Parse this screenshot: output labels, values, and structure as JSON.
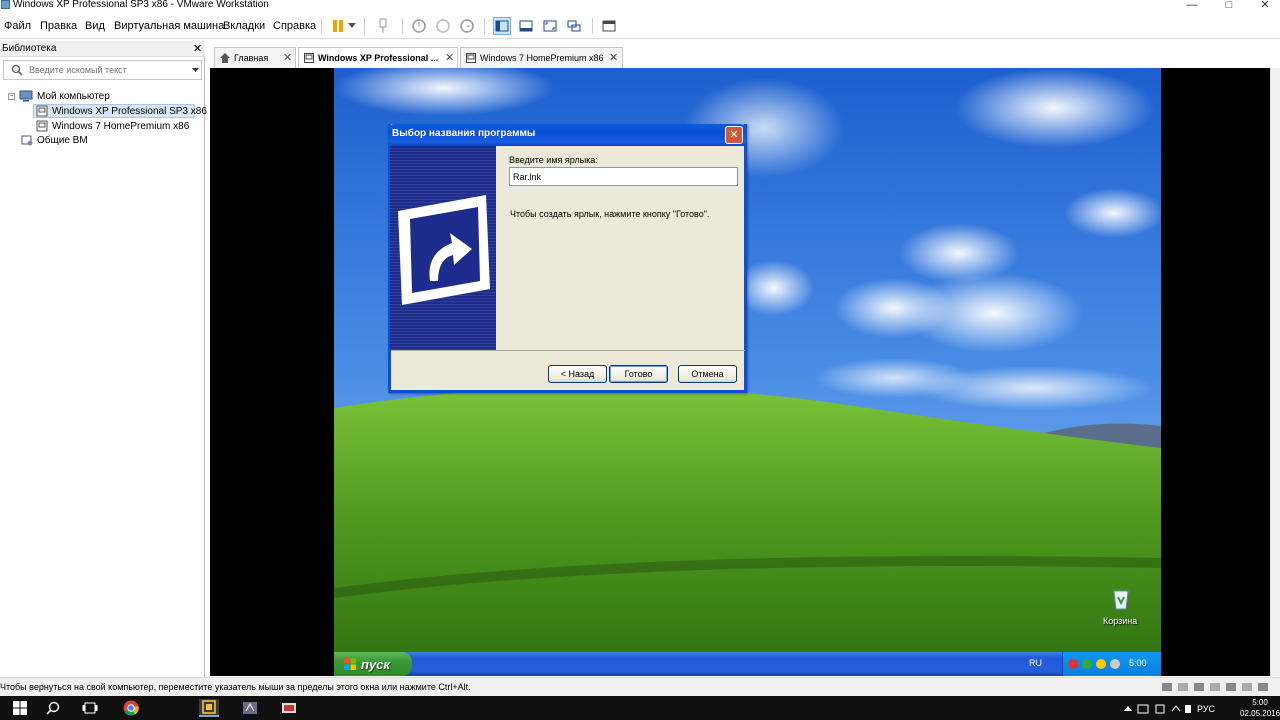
{
  "window": {
    "title": "Windows XP Professional SP3 x86 - VMware Workstation",
    "minimize_icon": "minimize-icon",
    "maximize_icon": "maximize-icon",
    "close_icon": "close-icon",
    "minimize_glyph": "—",
    "maximize_glyph": "□",
    "close_glyph": "✕"
  },
  "menu": [
    "Файл",
    "Правка",
    "Вид",
    "Виртуальная машина",
    "Вкладки",
    "Справка"
  ],
  "library": {
    "title": "Библиотека",
    "close_glyph": "✕",
    "search_placeholder": "Введите искомый текст",
    "tree": {
      "root": "Мой компьютер",
      "vm1": "Windows XP Professional SP3 x86",
      "vm2": "Windows 7 HomePremium x86",
      "shared": "Общие ВМ",
      "collapse_glyph": "−"
    }
  },
  "tabs": [
    {
      "label": "Главная",
      "close": "✕"
    },
    {
      "label": "Windows XP Professional ...",
      "close": "✕"
    },
    {
      "label": "Windows 7 HomePremium x86",
      "close": "✕"
    }
  ],
  "dialog": {
    "title": "Выбор названия программы",
    "close_glyph": "✕",
    "field_label": "Введите имя ярлыка:",
    "field_value": "Rar.lnk",
    "hint": "Чтобы создать ярлык, нажмите кнопку \"Готово\".",
    "back_label": "< Назад",
    "finish_label": "Готово",
    "cancel_label": "Отмена"
  },
  "xp": {
    "start_label": "пуск",
    "lang": "RU",
    "time": "5:00",
    "recycle_label": "Корзина"
  },
  "status": {
    "text": "Чтобы вернуться на свой компьютер, переместите указатель мыши за пределы этого окна или нажмите Ctrl+Alt."
  },
  "w10": {
    "lang": "РУС",
    "time": "5:00",
    "date": "02.05.2016"
  },
  "colors": {
    "xp_blue": "#245edb",
    "xp_start_green": "#3a9a37",
    "dialog_bg": "#ece9d8",
    "sky": "#2f6fd6",
    "grass": "#4e9b22"
  }
}
